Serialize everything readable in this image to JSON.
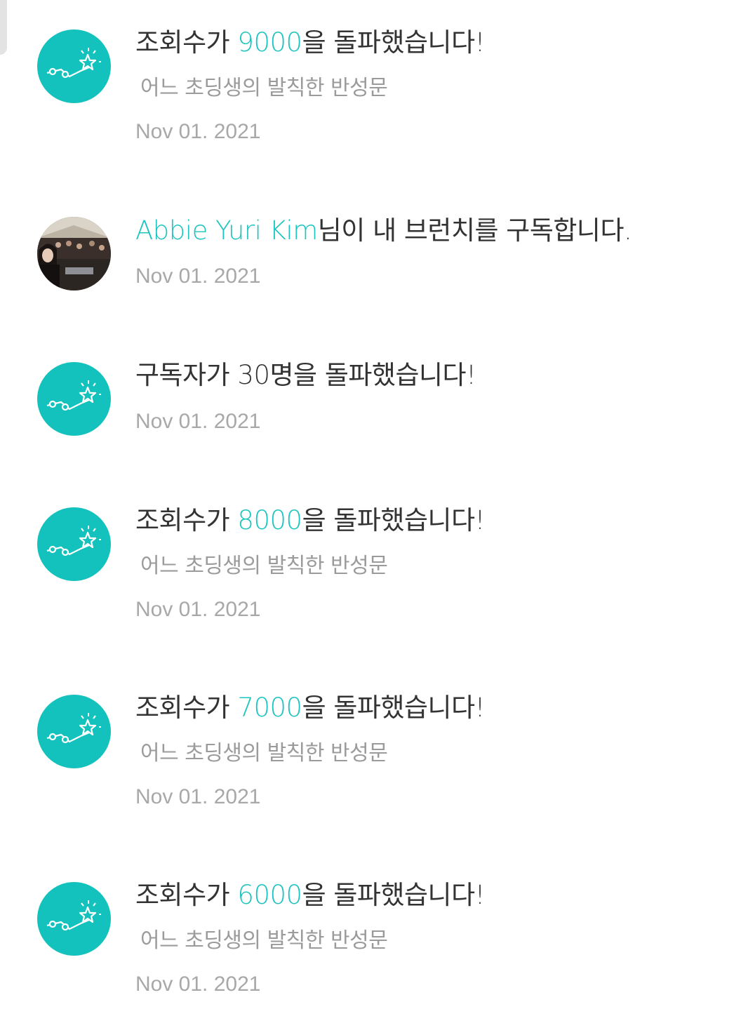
{
  "notifications": [
    {
      "avatar": "milestone-chart-icon",
      "title_prefix": "조회수가 ",
      "title_highlight": "9000",
      "title_suffix": "을 돌파했습니다!",
      "subtitle": "어느 초딩생의 발칙한 반성문",
      "date": "Nov 01. 2021"
    },
    {
      "avatar": "user-photo",
      "title_prefix": "",
      "title_highlight": "Abbie Yuri Kim",
      "title_suffix": "님이 내 브런치를 구독합니다.",
      "subtitle": "",
      "date": "Nov 01. 2021"
    },
    {
      "avatar": "milestone-chart-icon",
      "title_prefix": "구독자가 30명을 돌파했습니다!",
      "title_highlight": "",
      "title_suffix": "",
      "subtitle": "",
      "date": "Nov 01. 2021"
    },
    {
      "avatar": "milestone-chart-icon",
      "title_prefix": "조회수가 ",
      "title_highlight": "8000",
      "title_suffix": "을 돌파했습니다!",
      "subtitle": "어느 초딩생의 발칙한 반성문",
      "date": "Nov 01. 2021"
    },
    {
      "avatar": "milestone-chart-icon",
      "title_prefix": "조회수가 ",
      "title_highlight": "7000",
      "title_suffix": "을 돌파했습니다!",
      "subtitle": "어느 초딩생의 발칙한 반성문",
      "date": "Nov 01. 2021"
    },
    {
      "avatar": "milestone-chart-icon",
      "title_prefix": "조회수가 ",
      "title_highlight": "6000",
      "title_suffix": "을 돌파했습니다!",
      "subtitle": "어느 초딩생의 발칙한 반성문",
      "date": "Nov 01. 2021"
    }
  ],
  "colors": {
    "accent": "#1cc4bf",
    "badge": "#13c2bd",
    "title": "#333333",
    "subtitle": "#9b9b9b",
    "date": "#a8a8a8"
  }
}
